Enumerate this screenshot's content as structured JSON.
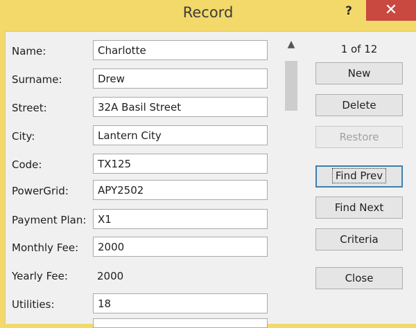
{
  "window": {
    "title": "Record",
    "help_label": "?",
    "close_label": "✕"
  },
  "fields": [
    {
      "label": "Name:",
      "value": "Charlotte"
    },
    {
      "label": "Surname:",
      "value": "Drew"
    },
    {
      "label": "Street:",
      "value": "32A Basil Street"
    },
    {
      "label": "City:",
      "value": "Lantern City"
    },
    {
      "label": "Code:",
      "value": "TX125"
    },
    {
      "label": "PowerGrid:",
      "value": "APY2502"
    },
    {
      "label": "Payment Plan:",
      "value": "X1"
    },
    {
      "label": "Monthly Fee:",
      "value": "2000"
    },
    {
      "label": "Yearly Fee:",
      "value": "2000"
    },
    {
      "label": "Utilities:",
      "value": "18"
    }
  ],
  "scrollbar": {
    "up_icon": "▲"
  },
  "record_counter": "1 of 12",
  "buttons": {
    "new": "New",
    "delete": "Delete",
    "restore": "Restore",
    "find_prev": "Find Prev",
    "find_next": "Find Next",
    "criteria": "Criteria",
    "close": "Close"
  }
}
